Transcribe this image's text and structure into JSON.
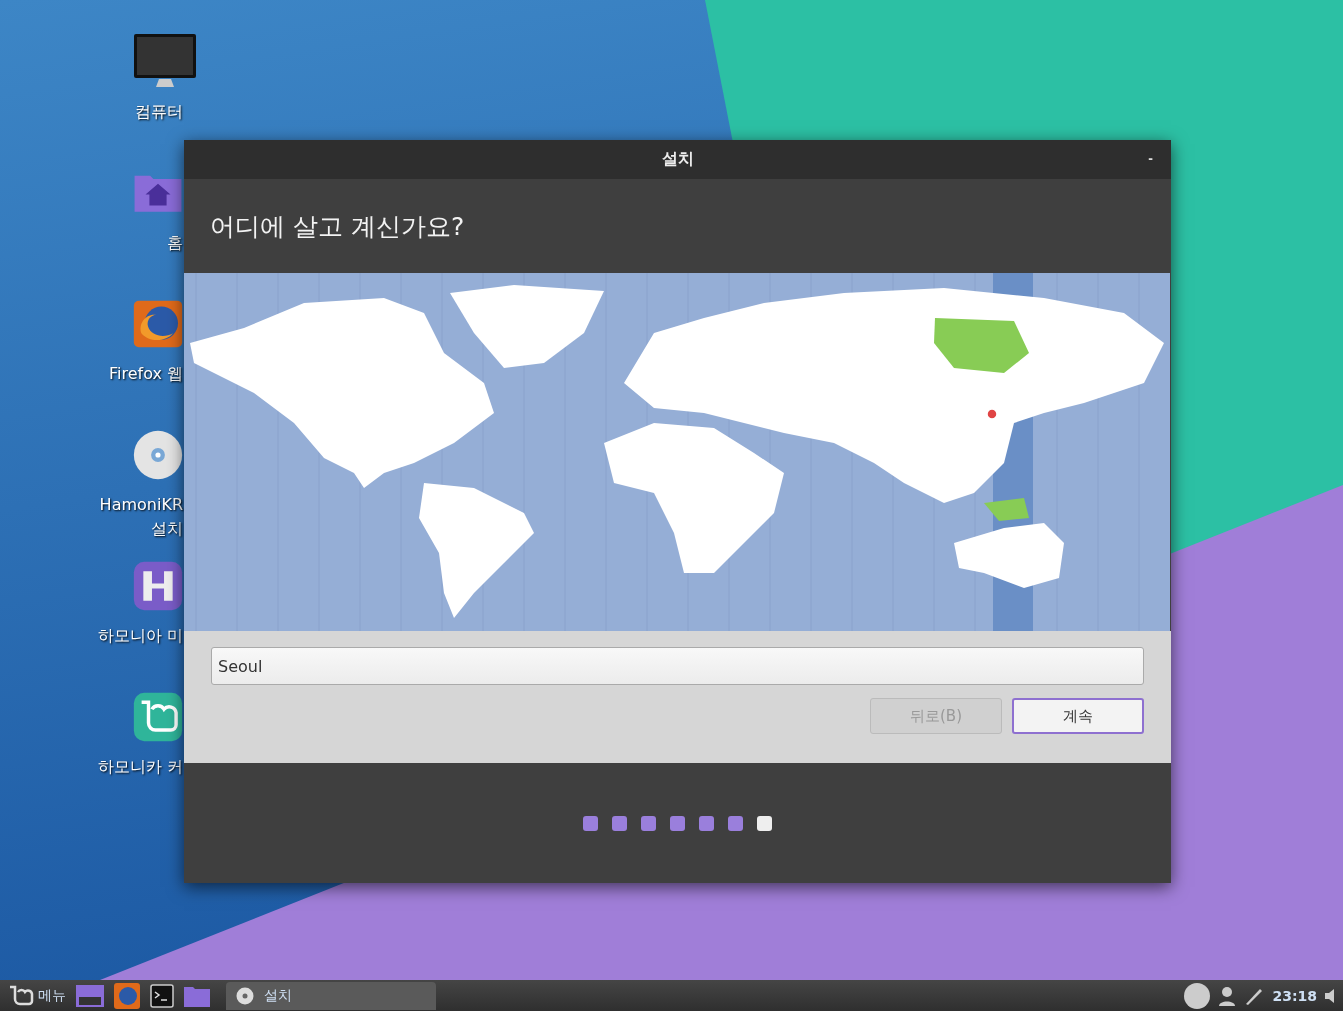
{
  "desktop_icons": [
    {
      "label": "컴퓨터"
    },
    {
      "label": "홈"
    },
    {
      "label": "Firefox 웹"
    },
    {
      "label": "HamoniKR\n설치"
    },
    {
      "label": "하모니아 미"
    },
    {
      "label": "하모니카 커"
    }
  ],
  "window": {
    "title": "설치",
    "minimize": "-",
    "heading": "어디에 살고 계신가요?",
    "location_field": {
      "value": "Seoul"
    },
    "buttons": [
      {
        "label": "뒤로(B)",
        "disabled": true
      },
      {
        "label": "계속",
        "disabled": false
      }
    ],
    "steps": [
      {
        "selected": false
      },
      {
        "selected": false
      },
      {
        "selected": false
      },
      {
        "selected": false
      },
      {
        "selected": false
      },
      {
        "selected": false
      },
      {
        "selected": true
      }
    ]
  },
  "taskbar": {
    "menu_label": "메뉴",
    "task": {
      "label": "설치"
    },
    "clock": "23:18"
  }
}
